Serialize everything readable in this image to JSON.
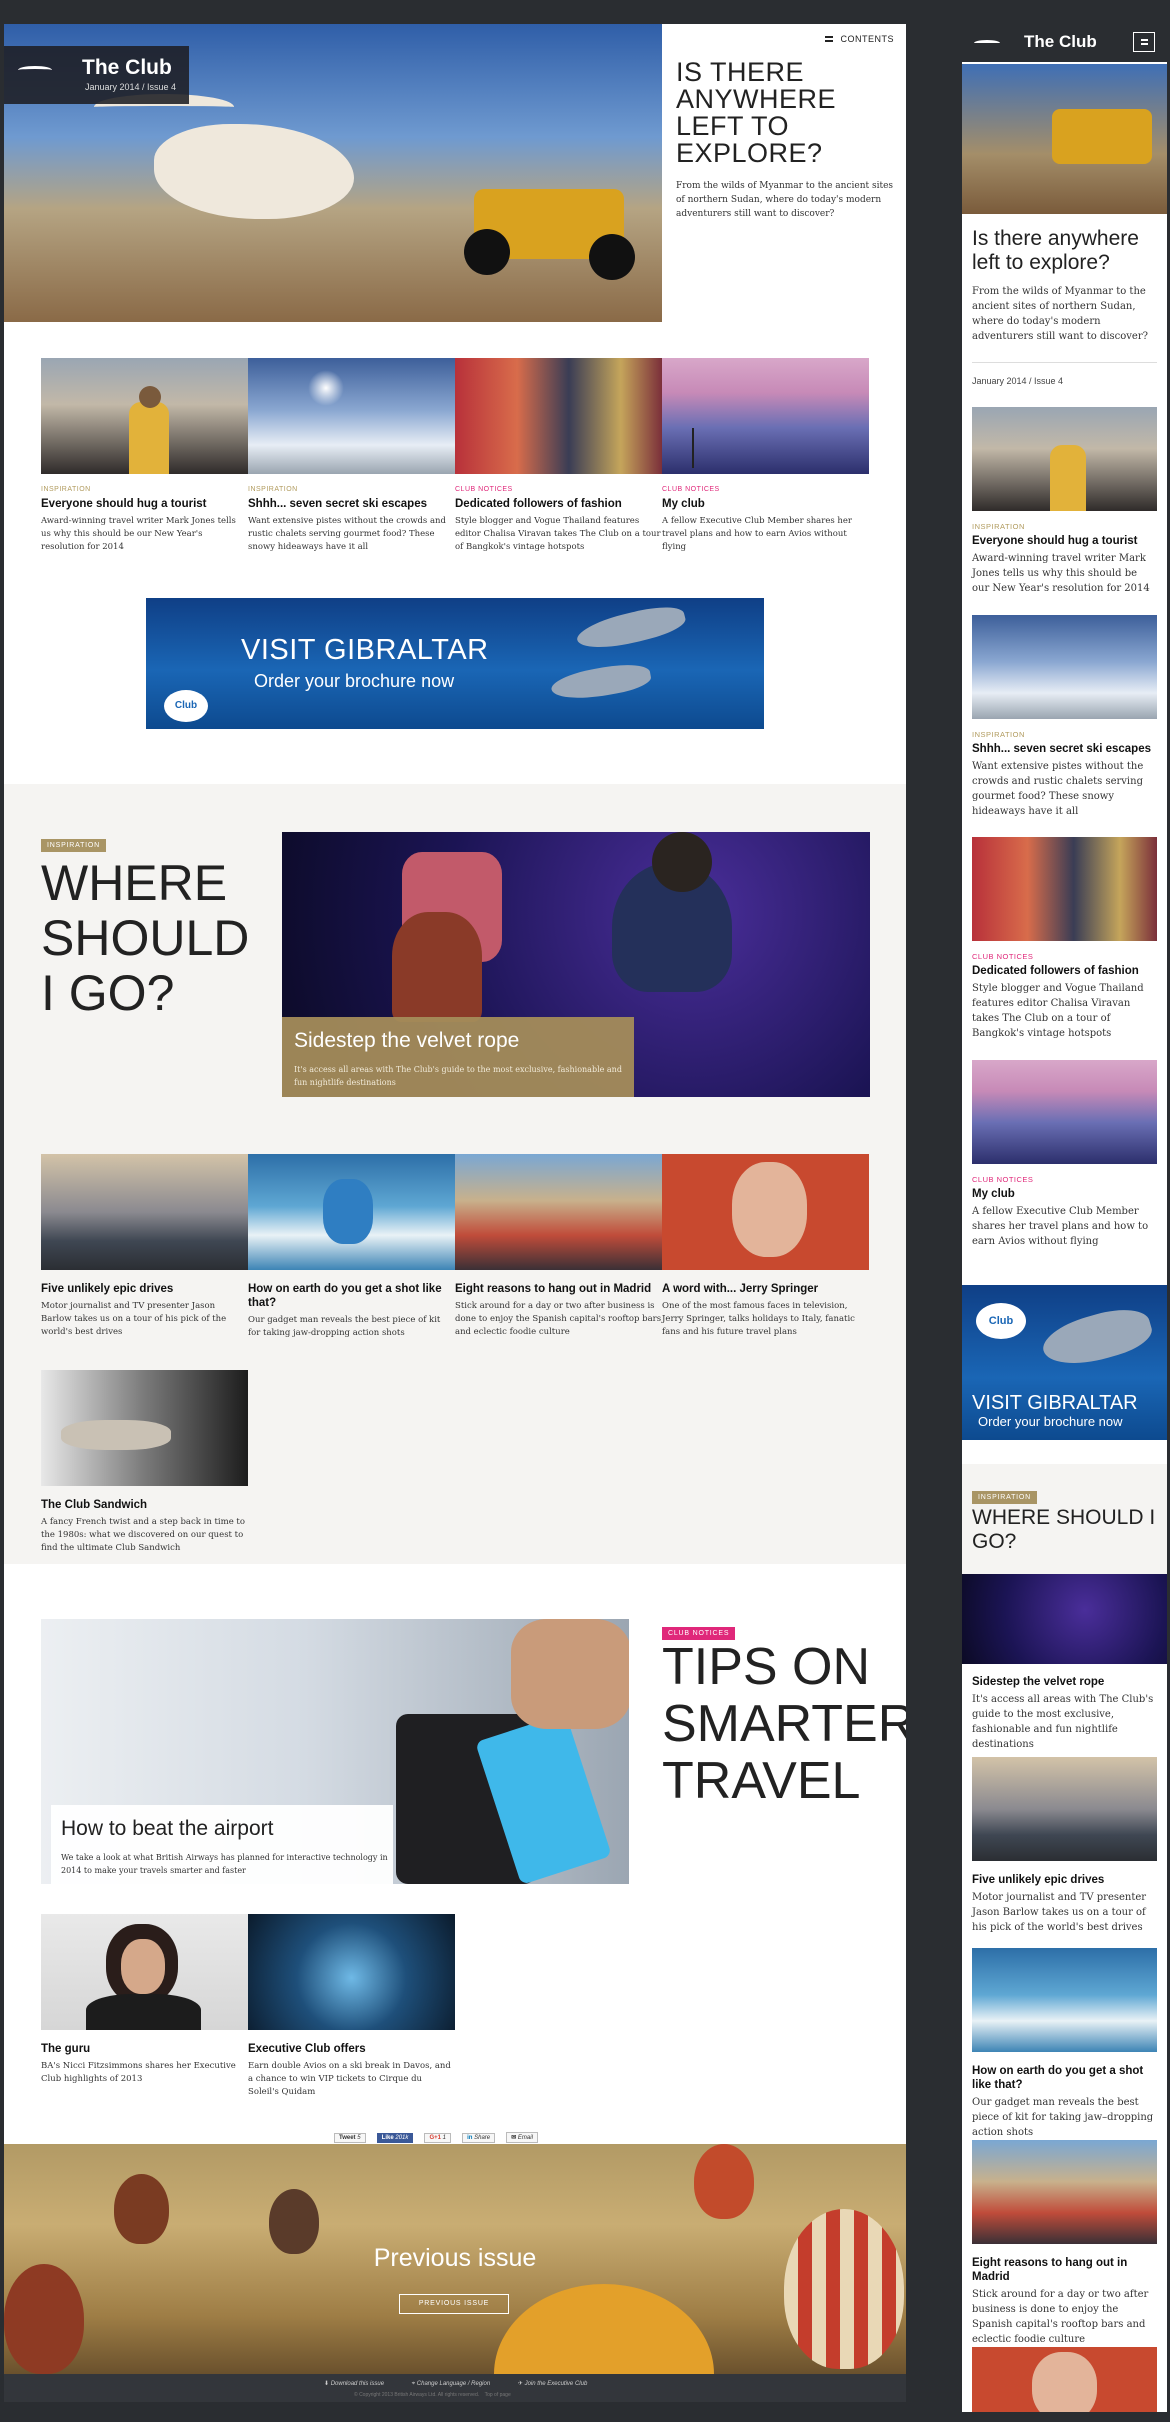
{
  "brand": {
    "name": "The Club",
    "issue": "January 2014 / Issue 4"
  },
  "nav": {
    "contents_label": "CONTENTS"
  },
  "hero": {
    "title": "IS THERE ANYWHERE LEFT TO EXPLORE?",
    "description": "From the wilds of Myanmar to the ancient sites of northern Sudan, where do today's modern adventurers still want to discover?"
  },
  "articles_row1": [
    {
      "category": "INSPIRATION",
      "title": "Everyone should hug a tourist",
      "description": "Award-winning travel writer Mark Jones tells us why this should be our New Year's resolution for 2014"
    },
    {
      "category": "INSPIRATION",
      "title": "Shhh... seven secret ski escapes",
      "description": "Want extensive pistes without the crowds and rustic chalets serving gourmet food? These snowy hideaways have it all"
    },
    {
      "category": "CLUB NOTICES",
      "title": "Dedicated followers of fashion",
      "description": "Style blogger and Vogue Thailand features editor Chalisa Viravan takes The Club on a tour of Bangkok's vintage hotspots"
    },
    {
      "category": "CLUB NOTICES",
      "title": "My club",
      "description": "A fellow Executive Club Member shares her travel plans and how to earn Avios without flying"
    }
  ],
  "ad": {
    "line1": "VISIT GIBRALTAR",
    "line2": "Order your brochure now",
    "logo": "Club"
  },
  "where_section": {
    "tag": "INSPIRATION",
    "heading_lines": [
      "WHERE",
      "SHOULD",
      "I GO?"
    ],
    "feature_title": "Sidestep the velvet rope",
    "feature_description": "It's access all areas with The Club's guide to the most exclusive, fashionable and fun nightlife destinations",
    "articles": [
      {
        "title": "Five unlikely epic drives",
        "description": "Motor journalist and TV presenter Jason Barlow takes us on a tour of his pick of the world's best drives"
      },
      {
        "title": "How on earth do you get a shot like that?",
        "description": "Our gadget man reveals the best piece of kit for taking jaw-dropping action shots"
      },
      {
        "title": "Eight reasons to hang out in Madrid",
        "description": "Stick around for a day or two after business is done to enjoy the Spanish capital's rooftop bars and eclectic foodie culture"
      },
      {
        "title": "A word with... Jerry Springer",
        "description": "One of the most famous faces in television, Jerry Springer, talks holidays to Italy, fanatic fans and his future travel plans"
      },
      {
        "title": "The Club Sandwich",
        "description": "A fancy French twist and a step back in time to the 1980s: what we discovered on our quest to find the ultimate Club Sandwich"
      }
    ]
  },
  "tips_section": {
    "tag": "CLUB NOTICES",
    "heading_lines": [
      "TIPS ON",
      "SMARTER",
      "TRAVEL"
    ],
    "feature_title": "How to beat the airport",
    "feature_description": "We take a look at what British Airways has planned for interactive technology in 2014 to make your travels smarter and faster",
    "articles": [
      {
        "title": "The guru",
        "description": "BA's Nicci Fitzsimmons shares her Executive Club highlights of 2013"
      },
      {
        "title": "Executive Club offers",
        "description": "Earn double Avios on a ski break in Davos, and a chance to win VIP tickets to Cirque du Soleil's Quidam"
      }
    ]
  },
  "share": {
    "tweet": "Tweet",
    "tweet_count": "5",
    "like": "Like",
    "like_count": "201k",
    "gplus": "G+1",
    "gplus_count": "1",
    "linkedin": "Share",
    "email": "Email"
  },
  "previous": {
    "title": "Previous issue",
    "button": "PREVIOUS ISSUE"
  },
  "footer": {
    "download": "Download this issue",
    "region": "Change Language / Region",
    "join": "Join the Executive Club",
    "copyright": "© Copyright 2013 British Airways Ltd. All rights reserved.",
    "top": "Top of page"
  },
  "mobile": {
    "hero_title": "Is there anywhere left to explore?",
    "hero_description": "From the wilds of Myanmar to the ancient sites of northern Sudan, where do today's modern adventurers still want to discover?",
    "issue": "January 2014 / Issue 4",
    "where_heading": "WHERE SHOULD I GO?",
    "where_tag": "INSPIRATION",
    "where_items": [
      {
        "title": "Sidestep the velvet rope",
        "description": "It's access all areas with The Club's guide to the most exclusive, fashionable and fun nightlife destinations"
      },
      {
        "title": "Five unlikely epic drives",
        "description": "Motor journalist and TV presenter Jason Barlow takes us on a tour of his pick of the world's best drives"
      },
      {
        "title": "How on earth do you get a shot like that?",
        "description": "Our gadget man reveals the best piece of kit for taking jaw–dropping action shots"
      },
      {
        "title": "Eight reasons to hang out in Madrid",
        "description": "Stick around for a day or two after business is done to enjoy the Spanish capital's rooftop bars and eclectic foodie culture"
      }
    ]
  },
  "colors": {
    "inspiration": "#b19b5e",
    "club_notices": "#e0287a",
    "dark": "#2a2d31",
    "gold": "#a99565"
  }
}
